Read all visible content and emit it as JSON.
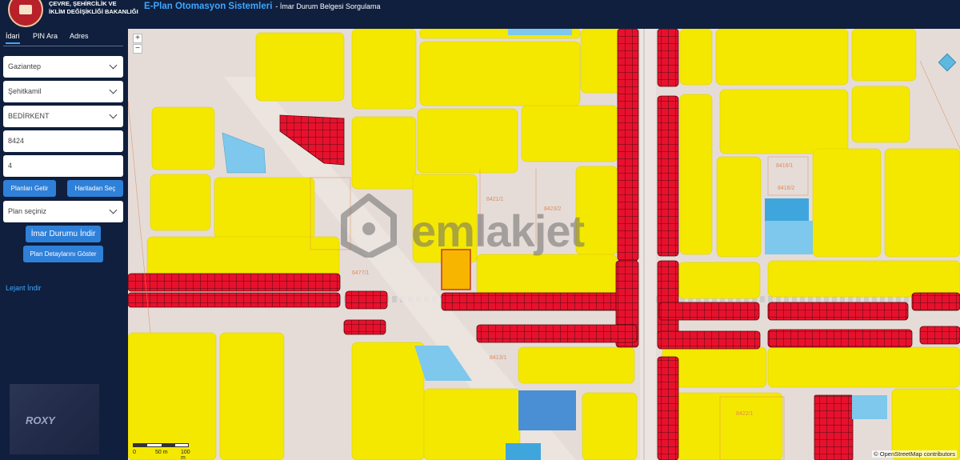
{
  "header": {
    "ministry_line1": "ÇEVRE, ŞEHİRCİLİK VE",
    "ministry_line2": "İKLİM DEĞİŞİKLİĞİ BAKANLIĞI",
    "app_title": "E-Plan Otomasyon Sistemleri",
    "app_subtitle": "- İmar Durum Belgesi Sorgulama"
  },
  "sidebar": {
    "tabs": [
      {
        "label": "İdari",
        "active": true
      },
      {
        "label": "PIN Ara",
        "active": false
      },
      {
        "label": "Adres",
        "active": false
      }
    ],
    "province": "Gaziantep",
    "district": "Şehitkamil",
    "neighborhood": "BEDİRKENT",
    "block": "8424",
    "parcel": "4",
    "btn_get_plans": "Planları Getir",
    "btn_select_map": "Haritadan Seç",
    "plan_select": "Plan seçiniz",
    "btn_download": "İmar Durumu İndir",
    "btn_details": "Plan Detaylarını Göster",
    "legend_link": "Lejant İndir",
    "watermark": "ROXY"
  },
  "map": {
    "zoom_in": "+",
    "zoom_out": "−",
    "scale_labels": [
      "0",
      "50 m",
      "100 m"
    ],
    "attribution": "© OpenStreetMap contributors",
    "watermark": "emlakjet",
    "parcel_labels": [
      "8421/1",
      "8423/2",
      "8416/1",
      "8416/2",
      "6477/1",
      "8413/1",
      "8422/1"
    ],
    "colors": {
      "residential": "#f5e800",
      "commercial": "#e8112d",
      "selected": "#f7b500",
      "park": "#7dc8ec",
      "school": "#4a8fd4",
      "road": "#ebe4e0",
      "parcel_line": "#e08a5a"
    }
  }
}
